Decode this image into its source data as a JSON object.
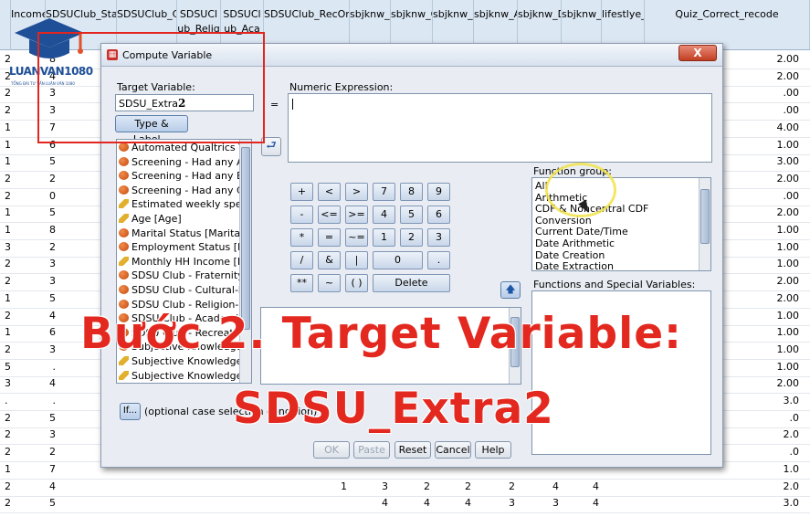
{
  "header": {
    "columns": [
      "Income",
      "SDSUClub_StatSor",
      "SDSUClub_Cultural",
      "SDSUCl ub_Relig",
      "SDSUCl ub_Aca",
      "SDSUClub_RecOrSport",
      "sbjknw_Overall",
      "sbjknw_Qual",
      "sbjknw_Rec",
      "sbjknw_AmngFr",
      "sbjknw_DontKnc",
      "sbjknw_Diff",
      "lifestlye_CraftBe",
      "Quiz_Correct_recode"
    ]
  },
  "rows": [
    {
      "n": "2",
      "a": "8",
      "z": "2.00"
    },
    {
      "n": "2",
      "a": "4",
      "z": "2.00"
    },
    {
      "n": "2",
      "a": "3",
      "z": ".00"
    },
    {
      "n": "2",
      "a": "3",
      "z": ".00"
    },
    {
      "n": "1",
      "a": "7",
      "z": "4.00"
    },
    {
      "n": "1",
      "a": "6",
      "z": "1.00"
    },
    {
      "n": "1",
      "a": "5",
      "z": "3.00"
    },
    {
      "n": "2",
      "a": "2",
      "z": "2.00"
    },
    {
      "n": "2",
      "a": "0",
      "z": ".00"
    },
    {
      "n": "1",
      "a": "5",
      "z": "2.00"
    },
    {
      "n": "1",
      "a": "8",
      "z": "1.00"
    },
    {
      "n": "3",
      "a": "2",
      "z": "1.00"
    },
    {
      "n": "2",
      "a": "3",
      "z": "1.00"
    },
    {
      "n": "2",
      "a": "3",
      "z": "2.00"
    },
    {
      "n": "1",
      "a": "5",
      "z": "2.00"
    },
    {
      "n": "2",
      "a": "4",
      "z": "1.00"
    },
    {
      "n": "1",
      "a": "6",
      "z": "1.00"
    },
    {
      "n": "2",
      "a": "3",
      "z": "1.00"
    },
    {
      "n": "5",
      "a": ".",
      "z": "1.00"
    },
    {
      "n": "3",
      "a": "4",
      "z": "2.00"
    },
    {
      "n": ".",
      "a": ".",
      "z": "3.0"
    },
    {
      "n": "2",
      "a": "5",
      "z": ".0"
    },
    {
      "n": "2",
      "a": "3",
      "z": "2.0"
    },
    {
      "n": "2",
      "a": "2",
      "z": ".0"
    },
    {
      "n": "1",
      "a": "7",
      "z": "1.0"
    },
    {
      "n": "2",
      "a": "4",
      "z": "2.0"
    },
    {
      "n": "2",
      "a": "5",
      "z": "3.0"
    }
  ],
  "bottom_rows": [
    {
      "c5": "1",
      "c6": "3",
      "c7": "2",
      "c8": "2",
      "c9": "2",
      "c10": "4",
      "c11": "4"
    },
    {
      "c6": "4",
      "c7": "4",
      "c8": "4",
      "c9": "3",
      "c10": "3",
      "c11": "4"
    }
  ],
  "logo": {
    "main": "LUANVAN1080",
    "sub": "TỔNG ĐÀI TƯ VẤN LUẬN VĂN 1080"
  },
  "dialog": {
    "title": "Compute Variable",
    "close": "X",
    "target_label": "Target Variable:",
    "target_value": "SDSU_Extra",
    "target_suffix": "2",
    "equals": "=",
    "numeric_label": "Numeric Expression:",
    "type_label_btn": "Type & Label...",
    "function_group_label": "Function group:",
    "function_groups": [
      "All",
      "Arithmetic",
      "CDF & Noncentral CDF",
      "Conversion",
      "Current Date/Time",
      "Date Arithmetic",
      "Date Creation",
      "Date Extraction"
    ],
    "special_label": "Functions and Special Variables:",
    "variables": [
      "Automated Qualtrics Va...",
      "Screening - Had any AL...",
      "Screening - Had any B...",
      "Screening - Had any C...",
      "Estimated weekly spen...",
      "Age [Age]",
      "Marital Status [Marital_...",
      "Employment Status [E...",
      "Monthly HH Income [Inc...",
      "SDSU Club - Fraternity ...",
      "SDSU Club - Cultural-b...",
      "SDSU Club - Religion-b...",
      "SDSU Club - Academic ...",
      "SDSU Club - Recreatio...",
      "Subjective Knowledge -...",
      "Subjective Knowledge -...",
      "Subjective Knowledge -..."
    ],
    "variable_icons": [
      "nominal",
      "nominal",
      "nominal",
      "nominal",
      "scale",
      "scale",
      "nominal",
      "nominal",
      "scale",
      "nominal",
      "nominal",
      "nominal",
      "nominal",
      "nominal",
      "nominal",
      "scale",
      "scale"
    ],
    "keypad": [
      [
        "+",
        "<",
        ">",
        "7",
        "8",
        "9"
      ],
      [
        "-",
        "<=",
        ">=",
        "4",
        "5",
        "6"
      ],
      [
        "*",
        "=",
        "~=",
        "1",
        "2",
        "3"
      ],
      [
        "/",
        "&",
        "|",
        "0",
        "."
      ],
      [
        "**",
        "~",
        "( )",
        "Delete"
      ]
    ],
    "if_btn": "If...",
    "if_text": "(optional case selection condition)",
    "buttons": {
      "ok": "OK",
      "paste": "Paste",
      "reset": "Reset",
      "cancel": "Cancel",
      "help": "Help"
    }
  },
  "caption": {
    "line1": "Bước 2. Target Variable:",
    "line2": "SDSU_Extra2"
  }
}
